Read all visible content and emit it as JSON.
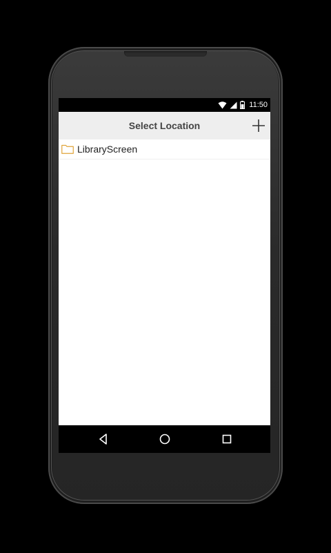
{
  "status_bar": {
    "time": "11:50",
    "icons": [
      "wifi-icon",
      "cell-signal-icon",
      "battery-icon"
    ]
  },
  "action_bar": {
    "title": "Select Location",
    "add_icon": "plus-icon"
  },
  "folders": [
    {
      "label": "LibraryScreen",
      "icon": "folder-icon"
    }
  ],
  "nav_bar": {
    "buttons": [
      "back-icon",
      "home-icon",
      "recent-apps-icon"
    ]
  },
  "colors": {
    "action_bar_bg": "#eeeeee",
    "title_text": "#444444",
    "folder_outline": "#e0a43a",
    "status_bar_bg": "#000000"
  }
}
